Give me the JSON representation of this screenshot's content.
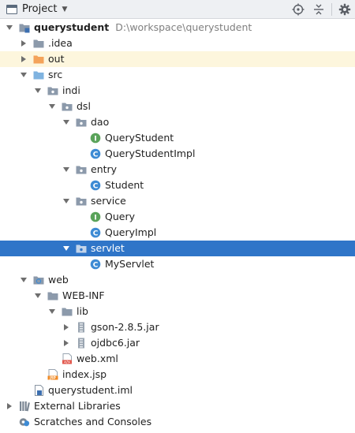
{
  "panel": {
    "title": "Project",
    "title_icon": "project-view-icon",
    "dropdown_icon": "chevron-down-icon",
    "toolbar_icons": [
      "locate-target-icon",
      "collapse-all-icon",
      "gear-icon"
    ]
  },
  "colors": {
    "selection": "#2f75c8",
    "excluded_highlight": "#fdf6dd",
    "folder": "#8c9aab",
    "excluded_folder": "#f4a35a",
    "source_folder": "#7fb3e0",
    "interface_badge": "#5aa35a",
    "class_badge": "#3e8bd4"
  },
  "tree": {
    "rows": [
      {
        "label": "querystudent",
        "extra": "D:\\workspace\\querystudent",
        "icon": "module-folder-icon",
        "arrow": "expanded",
        "level": 0,
        "bold": true
      },
      {
        "label": ".idea",
        "icon": "folder-icon",
        "arrow": "collapsed",
        "level": 1
      },
      {
        "label": "out",
        "icon": "excluded-folder-icon",
        "arrow": "collapsed",
        "level": 1,
        "highlight": true
      },
      {
        "label": "src",
        "icon": "source-folder-icon",
        "arrow": "expanded",
        "level": 1
      },
      {
        "label": "indi",
        "icon": "package-icon",
        "arrow": "expanded",
        "level": 2
      },
      {
        "label": "dsl",
        "icon": "package-icon",
        "arrow": "expanded",
        "level": 3
      },
      {
        "label": "dao",
        "icon": "package-icon",
        "arrow": "expanded",
        "level": 4
      },
      {
        "label": "QueryStudent",
        "icon": "interface-icon",
        "arrow": "none",
        "level": 5
      },
      {
        "label": "QueryStudentImpl",
        "icon": "class-icon",
        "arrow": "none",
        "level": 5
      },
      {
        "label": "entry",
        "icon": "package-icon",
        "arrow": "expanded",
        "level": 4
      },
      {
        "label": "Student",
        "icon": "class-icon",
        "arrow": "none",
        "level": 5
      },
      {
        "label": "service",
        "icon": "package-icon",
        "arrow": "expanded",
        "level": 4
      },
      {
        "label": "Query",
        "icon": "interface-icon",
        "arrow": "none",
        "level": 5
      },
      {
        "label": "QueryImpl",
        "icon": "class-icon",
        "arrow": "none",
        "level": 5
      },
      {
        "label": "servlet",
        "icon": "package-icon",
        "arrow": "expanded",
        "level": 4,
        "selected": true
      },
      {
        "label": "MyServlet",
        "icon": "class-icon",
        "arrow": "none",
        "level": 5
      },
      {
        "label": "web",
        "icon": "web-folder-icon",
        "arrow": "expanded",
        "level": 1
      },
      {
        "label": "WEB-INF",
        "icon": "folder-icon",
        "arrow": "expanded",
        "level": 2
      },
      {
        "label": "lib",
        "icon": "folder-icon",
        "arrow": "expanded",
        "level": 3
      },
      {
        "label": "gson-2.8.5.jar",
        "icon": "jar-icon",
        "arrow": "collapsed",
        "level": 4
      },
      {
        "label": "ojdbc6.jar",
        "icon": "jar-icon",
        "arrow": "collapsed",
        "level": 4
      },
      {
        "label": "web.xml",
        "icon": "web-xml-icon",
        "arrow": "none",
        "level": 3
      },
      {
        "label": "index.jsp",
        "icon": "jsp-file-icon",
        "arrow": "none",
        "level": 2
      },
      {
        "label": "querystudent.iml",
        "icon": "iml-file-icon",
        "arrow": "none",
        "level": 1
      },
      {
        "label": "External Libraries",
        "icon": "external-libraries-icon",
        "arrow": "collapsed",
        "level": 0
      },
      {
        "label": "Scratches and Consoles",
        "icon": "scratches-icon",
        "arrow": "none",
        "level": 0
      }
    ]
  }
}
